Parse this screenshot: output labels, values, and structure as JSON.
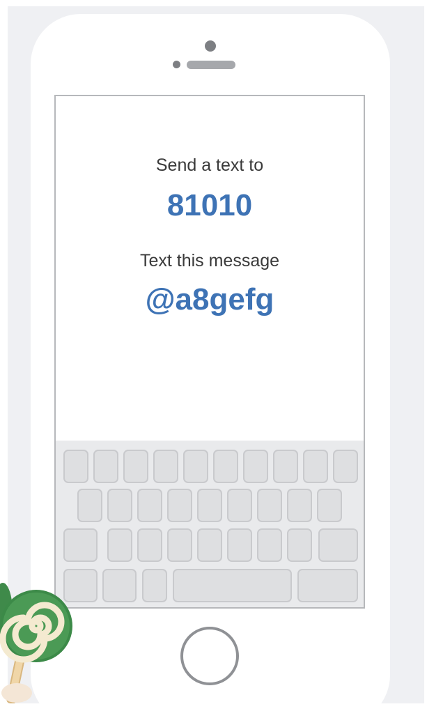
{
  "screen": {
    "send_label": "Send a text to",
    "phone_number": "81010",
    "message_label": "Text this message",
    "message_code": "@a8gefg"
  },
  "colors": {
    "accent": "#3e73b5",
    "label_text": "#3a3a3a",
    "page_background": "#eff0f3"
  },
  "icons": {
    "home_button": "home-button-icon",
    "decoration": "lollipop-icon"
  }
}
